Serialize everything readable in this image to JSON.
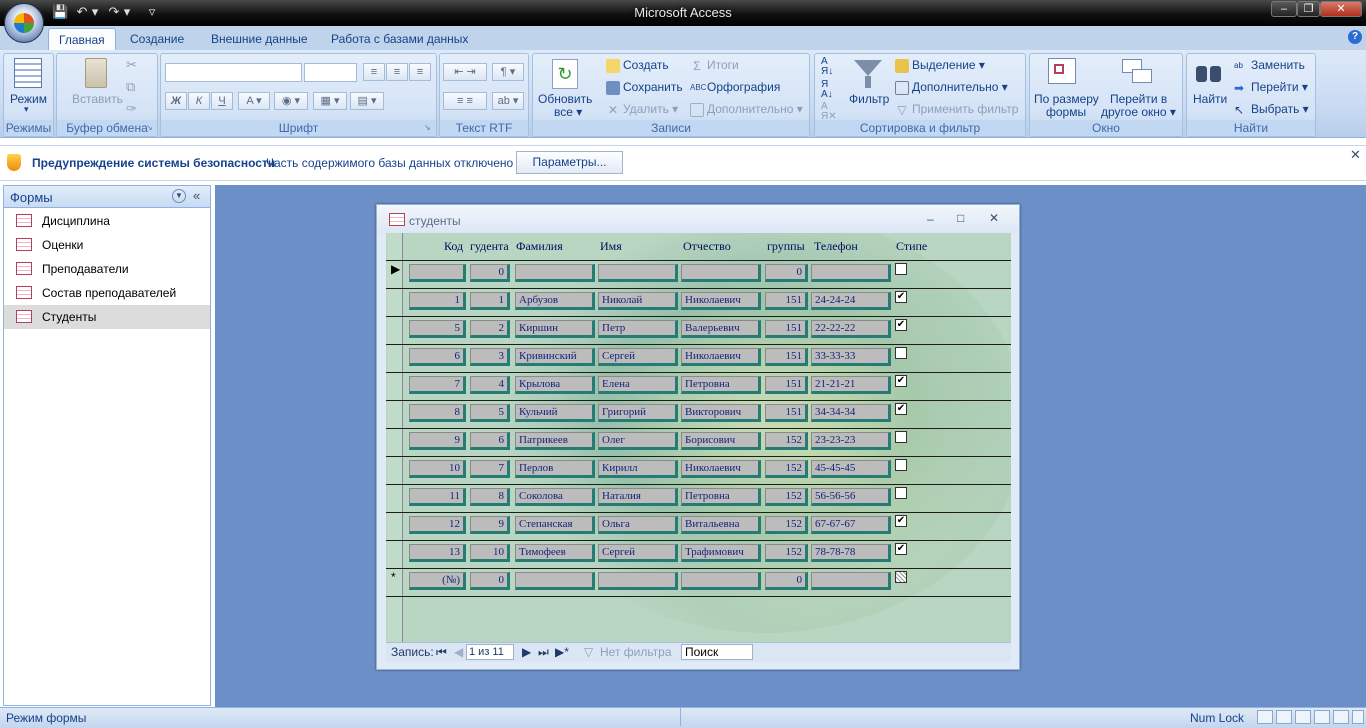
{
  "app_title": "Microsoft Access",
  "tabs": [
    "Главная",
    "Создание",
    "Внешние данные",
    "Работа с базами данных"
  ],
  "ribbon": {
    "views": {
      "mode_label": "Режим",
      "group": "Режимы"
    },
    "clipboard": {
      "paste_label": "Вставить",
      "group": "Буфер обмена"
    },
    "font": {
      "group": "Шрифт",
      "bold": "Ж",
      "italic": "К",
      "underline": "Ч"
    },
    "rtf": {
      "group": "Текст RTF"
    },
    "records": {
      "refresh_line1": "Обновить",
      "refresh_line2": "все ▾",
      "create": "Создать",
      "save": "Сохранить",
      "delete": "Удалить ▾",
      "totals": "Итоги",
      "spelling": "Орфография",
      "more": "Дополнительно ▾",
      "group": "Записи"
    },
    "sort": {
      "filter": "Фильтр",
      "selection": "Выделение ▾",
      "advanced": "Дополнительно ▾",
      "apply_filter": "Применить фильтр",
      "group": "Сортировка и фильтр"
    },
    "window": {
      "fit_line1": "По размеру",
      "fit_line2": "формы",
      "switch_line1": "Перейти в",
      "switch_line2": "другое окно ▾",
      "group": "Окно"
    },
    "find": {
      "find": "Найти",
      "replace": "Заменить",
      "goto": "Перейти ▾",
      "select": "Выбрать ▾",
      "group": "Найти"
    }
  },
  "security": {
    "title": "Предупреждение системы безопасности",
    "message": "Часть содержимого базы данных отключено",
    "button": "Параметры..."
  },
  "nav": {
    "header": "Формы",
    "items": [
      "Дисциплина",
      "Оценки",
      "Преподаватели",
      "Состав преподавателей",
      "Студенты"
    ],
    "selected": 4
  },
  "form": {
    "title": "студенты",
    "headers": [
      "Код",
      "гудента",
      "Фамилия",
      "Имя",
      "Отчество",
      "группы",
      "Телефон",
      "Стипе"
    ],
    "rows": [
      {
        "code": "",
        "num": "0",
        "last": "",
        "first": "",
        "middle": "",
        "group": "0",
        "phone": "",
        "stip": false
      },
      {
        "code": "1",
        "num": "1",
        "last": "Арбузов",
        "first": "Николай",
        "middle": "Николаевич",
        "group": "151",
        "phone": "24-24-24",
        "stip": true
      },
      {
        "code": "5",
        "num": "2",
        "last": "Киршин",
        "first": "Петр",
        "middle": "Валерьевич",
        "group": "151",
        "phone": "22-22-22",
        "stip": true
      },
      {
        "code": "6",
        "num": "3",
        "last": "Кривинский",
        "first": "Сергей",
        "middle": "Николаевич",
        "group": "151",
        "phone": "33-33-33",
        "stip": false
      },
      {
        "code": "7",
        "num": "4",
        "last": "Крылова",
        "first": "Елена",
        "middle": "Петровна",
        "group": "151",
        "phone": "21-21-21",
        "stip": true
      },
      {
        "code": "8",
        "num": "5",
        "last": "Кульчий",
        "first": "Григорий",
        "middle": "Викторович",
        "group": "151",
        "phone": "34-34-34",
        "stip": true
      },
      {
        "code": "9",
        "num": "6",
        "last": "Патрикеев",
        "first": "Олег",
        "middle": "Борисович",
        "group": "152",
        "phone": "23-23-23",
        "stip": false
      },
      {
        "code": "10",
        "num": "7",
        "last": "Перлов",
        "first": "Кирилл",
        "middle": "Николаевич",
        "group": "152",
        "phone": "45-45-45",
        "stip": false
      },
      {
        "code": "11",
        "num": "8",
        "last": "Соколова",
        "first": "Наталия",
        "middle": "Петровна",
        "group": "152",
        "phone": "56-56-56",
        "stip": false
      },
      {
        "code": "12",
        "num": "9",
        "last": "Степанская",
        "first": "Ольга",
        "middle": "Витальевна",
        "group": "152",
        "phone": "67-67-67",
        "stip": true
      },
      {
        "code": "13",
        "num": "10",
        "last": "Тимофеев",
        "first": "Сергей",
        "middle": "Трафимович",
        "group": "152",
        "phone": "78-78-78",
        "stip": true
      },
      {
        "code": "(№)",
        "num": "0",
        "last": "",
        "first": "",
        "middle": "",
        "group": "0",
        "phone": "",
        "stip": false
      }
    ],
    "record_nav": {
      "label": "Запись:",
      "position": "1 из 11",
      "filter": "Нет фильтра",
      "search": "Поиск"
    }
  },
  "status": {
    "left": "Режим формы",
    "numlock": "Num Lock"
  },
  "icons": [
    "save-icon",
    "undo-icon",
    "redo-icon",
    "cut-icon",
    "copy-icon",
    "format-painter-icon",
    "refresh-icon",
    "filter-icon",
    "binoculars-icon",
    "shield-icon",
    "form-icon",
    "close-icon"
  ]
}
